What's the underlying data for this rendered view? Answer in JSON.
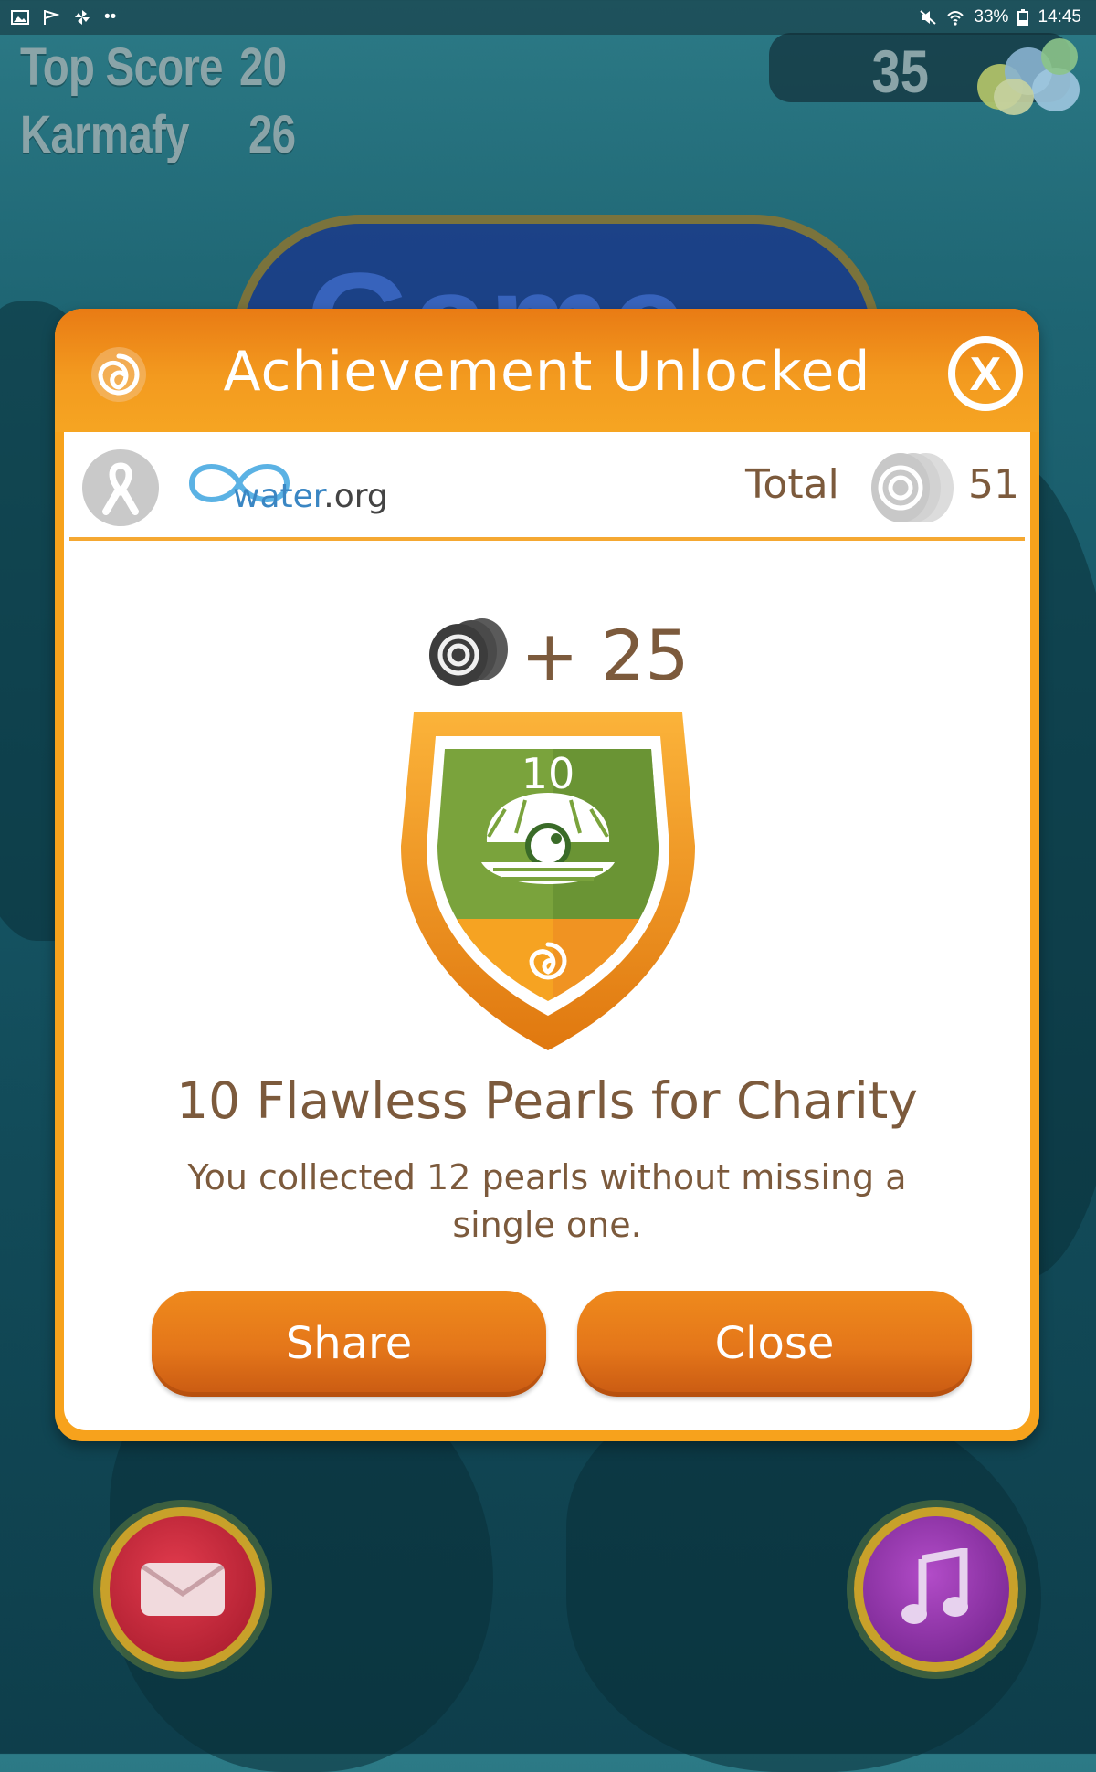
{
  "status_bar": {
    "battery": "33%",
    "time": "14:45"
  },
  "hud": {
    "top_score_label": "Top Score",
    "top_score_value": "20",
    "player_name": "Karmafy",
    "player_score": "26",
    "pearl_count": "35"
  },
  "dialog": {
    "title": "Achievement Unlocked",
    "close_symbol": "X",
    "charity": {
      "logo_text_main": "water",
      "logo_text_suffix": ".org"
    },
    "total_label": "Total",
    "total_value": "51",
    "reward": "+ 25",
    "badge_number": "10",
    "achievement_title": "10 Flawless Pearls for Charity",
    "achievement_description": "You collected 12 pearls without missing a single one.",
    "share_label": "Share",
    "close_label": "Close"
  },
  "colors": {
    "header_orange": "#ef8a1c",
    "frame_orange": "#f7a21c",
    "text_brown": "#7c5a3c",
    "badge_green": "#7aa33c",
    "charity_blue": "#3a86c3"
  },
  "icons": {
    "status_left": [
      "image-icon",
      "check-flag-icon",
      "pinwheel-icon",
      "more-dots-icon"
    ],
    "status_right": [
      "mute-icon",
      "wifi-icon",
      "battery-icon"
    ],
    "bottom_left": "mail-icon",
    "bottom_right": "music-note-icon"
  }
}
